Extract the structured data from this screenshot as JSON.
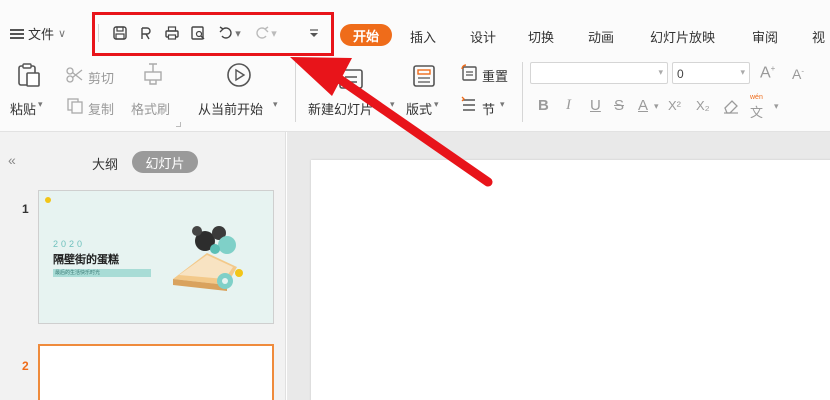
{
  "menubar": {
    "file_label": "文件",
    "tabs": [
      "插入",
      "设计",
      "切换",
      "动画",
      "幻灯片放映",
      "审阅",
      "视"
    ],
    "active_tab": "开始"
  },
  "ribbon": {
    "paste": "粘贴",
    "cut": "剪切",
    "copy": "复制",
    "format_painter": "格式刷",
    "from_current": "从当前开始",
    "new_slide": "新建幻灯片",
    "layout": "版式",
    "reset": "重置",
    "section": "节",
    "font_size": "0",
    "grow_font": "A",
    "shrink_font": "A",
    "bold": "B",
    "italic": "I",
    "underline": "U",
    "strike": "S",
    "font_color": "A",
    "superscript": "X²",
    "subscript": "X₂",
    "pinyin": "wén"
  },
  "left_panel": {
    "collapse": "«",
    "outline": "大纲",
    "slides": "幻灯片",
    "slides_list": [
      {
        "number": "1",
        "year": "2020",
        "title": "隔壁街的蛋糕",
        "subtitle": "最后的生活快乐时光"
      },
      {
        "number": "2"
      }
    ]
  },
  "colors": {
    "accent": "#ef6c1a",
    "highlight": "#e8141a"
  }
}
